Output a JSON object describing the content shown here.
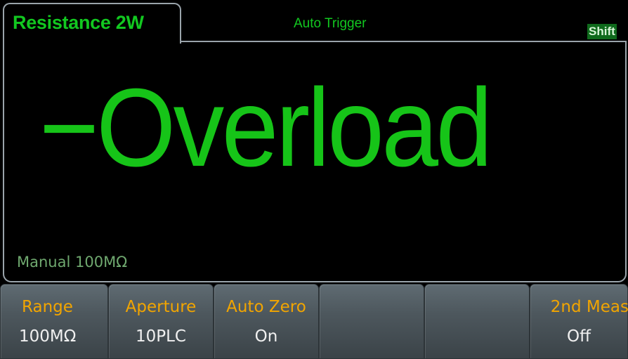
{
  "header": {
    "function_name": "Resistance 2W",
    "trigger_mode": "Auto Trigger",
    "shift_indicator": "Shift"
  },
  "display": {
    "reading": "−Overload",
    "range_status": "Manual 100MΩ"
  },
  "softkeys": [
    {
      "label": "Range",
      "value": "100MΩ"
    },
    {
      "label": "Aperture",
      "value": "10PLC"
    },
    {
      "label": "Auto Zero",
      "value": "On"
    },
    {
      "label": "",
      "value": ""
    },
    {
      "label": "",
      "value": ""
    },
    {
      "label": "2nd Meas",
      "value": "Off"
    }
  ],
  "colors": {
    "reading_green": "#16c418",
    "softkey_label": "#f2a500",
    "softkey_value": "#f0f0f0",
    "shift_bg": "#0f6a1c",
    "frame": "#9aa4ab"
  }
}
